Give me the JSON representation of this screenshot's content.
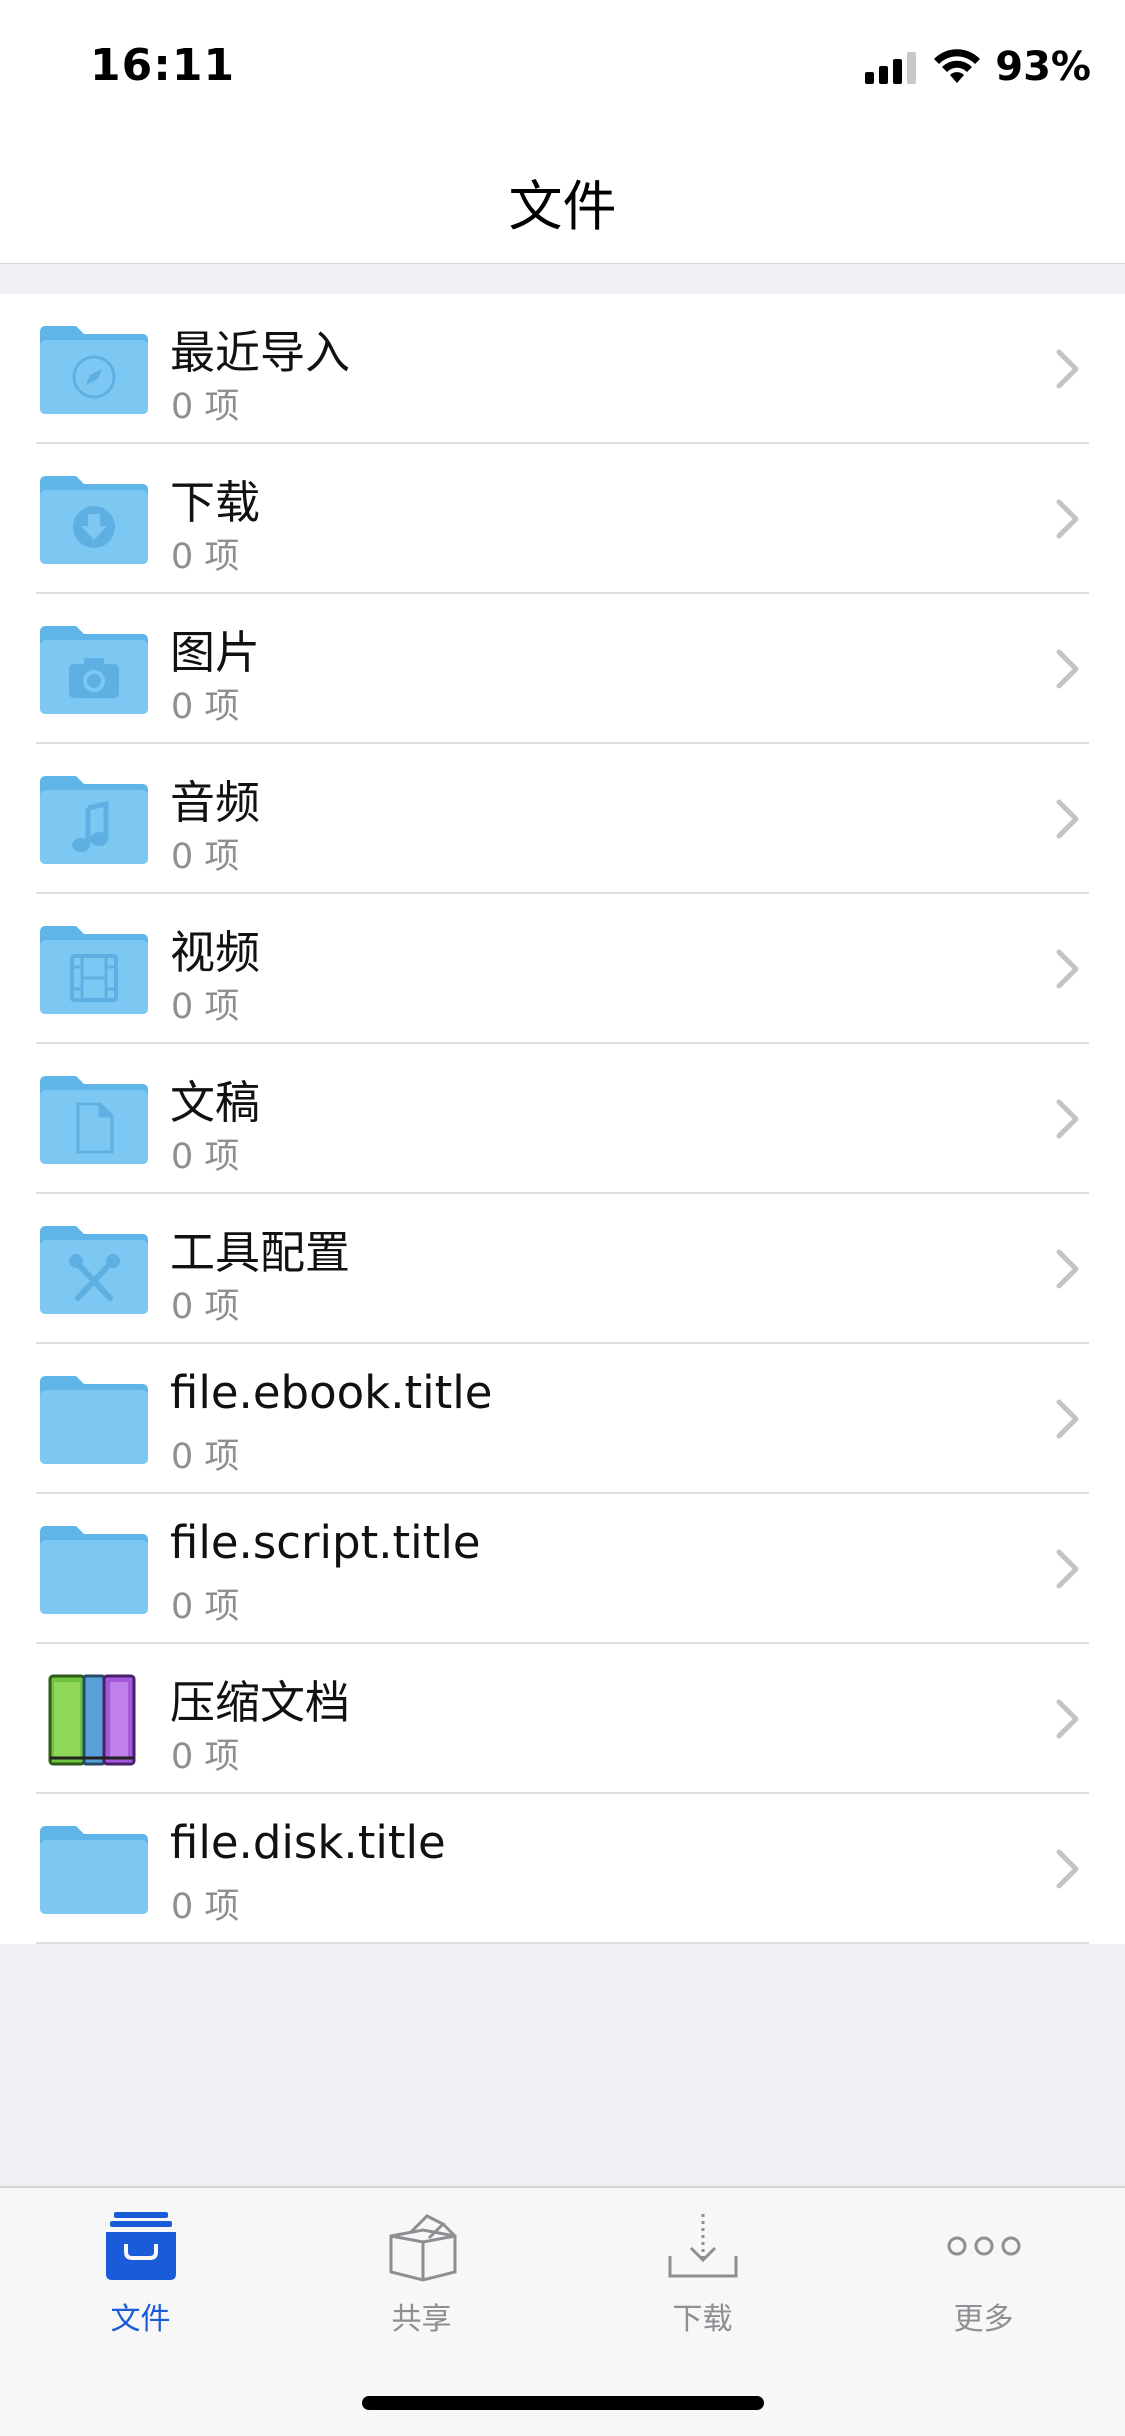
{
  "status": {
    "time": "16:11",
    "battery": "93%"
  },
  "nav": {
    "title": "文件"
  },
  "rows": [
    {
      "title": "最近导入",
      "subtitle": "0 项",
      "icon": "compass-folder-icon"
    },
    {
      "title": "下载",
      "subtitle": "0 项",
      "icon": "download-folder-icon"
    },
    {
      "title": "图片",
      "subtitle": "0 项",
      "icon": "camera-folder-icon"
    },
    {
      "title": "音频",
      "subtitle": "0 项",
      "icon": "music-folder-icon"
    },
    {
      "title": "视频",
      "subtitle": "0 项",
      "icon": "film-folder-icon"
    },
    {
      "title": "文稿",
      "subtitle": "0 项",
      "icon": "document-folder-icon"
    },
    {
      "title": "工具配置",
      "subtitle": "0 项",
      "icon": "tools-folder-icon"
    },
    {
      "title": "file.ebook.title",
      "subtitle": "0 项",
      "icon": "folder-icon"
    },
    {
      "title": "file.script.title",
      "subtitle": "0 项",
      "icon": "folder-icon"
    },
    {
      "title": "压缩文档",
      "subtitle": "0 项",
      "icon": "archive-books-icon"
    },
    {
      "title": "file.disk.title",
      "subtitle": "0 项",
      "icon": "folder-icon"
    }
  ],
  "tabs": [
    {
      "label": "文件",
      "icon": "files-tray-icon",
      "active": true
    },
    {
      "label": "共享",
      "icon": "share-box-icon",
      "active": false
    },
    {
      "label": "下载",
      "icon": "download-tray-icon",
      "active": false
    },
    {
      "label": "更多",
      "icon": "more-dots-icon",
      "active": false
    }
  ],
  "colors": {
    "accent": "#1a5bd8",
    "folder": "#7cc8f3",
    "folder_tab": "#5fb4e8",
    "secondary_text": "#8e8e93",
    "background": "#efeff4"
  }
}
